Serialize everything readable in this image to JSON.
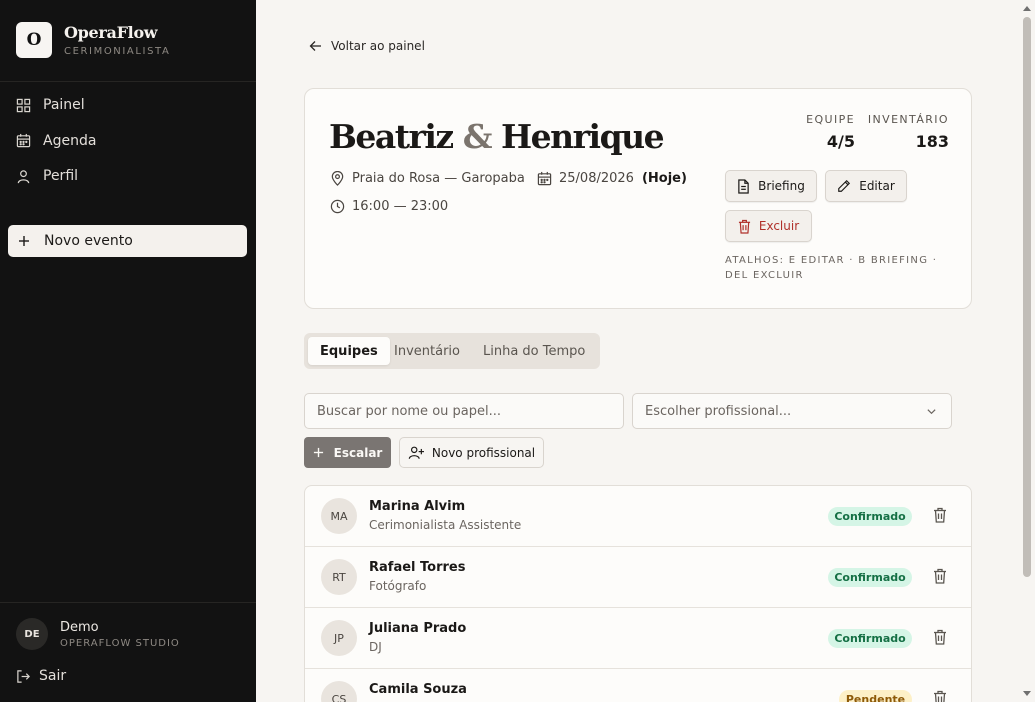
{
  "sidebar": {
    "logo_letter": "O",
    "app_name": "OperaFlow",
    "app_role": "CERIMONIALISTA",
    "nav": [
      {
        "label": "Painel",
        "icon": "grid-icon"
      },
      {
        "label": "Agenda",
        "icon": "calendar-icon"
      },
      {
        "label": "Perfil",
        "icon": "user-icon"
      }
    ],
    "new_event_label": "Novo evento",
    "user": {
      "initials": "DE",
      "name": "Demo",
      "org": "OPERAFLOW STUDIO"
    },
    "logout_label": "Sair"
  },
  "back_label": "Voltar ao painel",
  "event": {
    "name_1": "Beatriz",
    "amp": "&",
    "name_2": "Henrique",
    "location": "Praia do Rosa — Garopaba",
    "date": "25/08/2026",
    "today_label": "(Hoje)",
    "time": "16:00 — 23:00",
    "stats": {
      "team_label": "EQUIPE",
      "team_value": "4/5",
      "inventory_label": "INVENTÁRIO",
      "inventory_value": "183"
    },
    "buttons": {
      "briefing": "Briefing",
      "edit": "Editar",
      "delete": "Excluir"
    },
    "shortcuts_line1": "ATALHOS: E EDITAR · B BRIEFING ·",
    "shortcuts_line2": "DEL EXCLUIR"
  },
  "tabs": [
    {
      "label": "Equipes",
      "active": true
    },
    {
      "label": "Inventário",
      "active": false
    },
    {
      "label": "Linha do Tempo",
      "active": false
    }
  ],
  "search": {
    "placeholder": "Buscar por nome ou papel..."
  },
  "professional_select": {
    "placeholder": "Escolher profissional..."
  },
  "actions": {
    "assign": "Escalar",
    "new_professional": "Novo profissional"
  },
  "team": [
    {
      "initials": "MA",
      "name": "Marina Alvim",
      "role": "Cerimonialista Assistente",
      "status": "Confirmado",
      "status_kind": "ok"
    },
    {
      "initials": "RT",
      "name": "Rafael Torres",
      "role": "Fotógrafo",
      "status": "Confirmado",
      "status_kind": "ok"
    },
    {
      "initials": "JP",
      "name": "Juliana Prado",
      "role": "DJ",
      "status": "Confirmado",
      "status_kind": "ok"
    },
    {
      "initials": "CS",
      "name": "Camila Souza",
      "role": "",
      "status": "Pendente",
      "status_kind": "pend"
    }
  ],
  "colors": {
    "sidebar_bg": "#121212",
    "page_bg": "#f7f5f2",
    "confirmed_badge": "#d5f5e6",
    "pending_badge": "#fdf0c7",
    "danger": "#b0302a"
  }
}
